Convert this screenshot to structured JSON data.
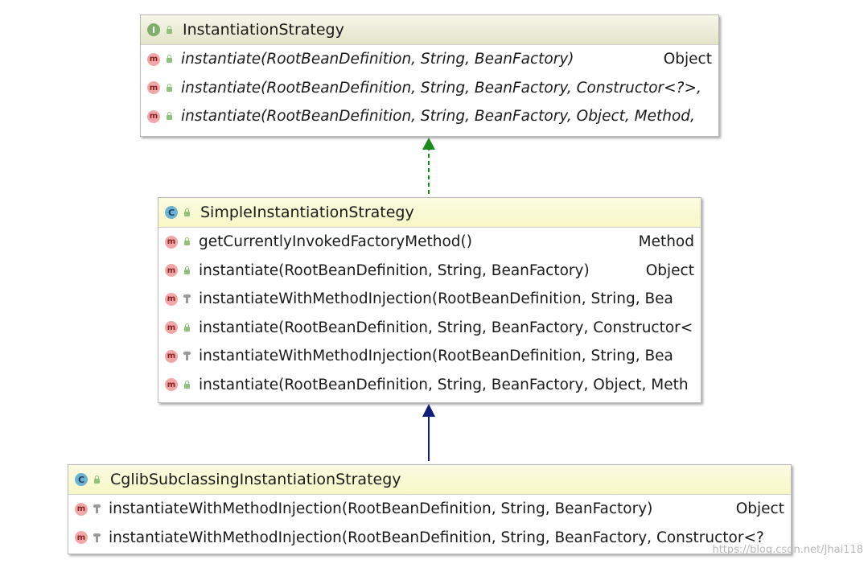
{
  "boxes": [
    {
      "kind": "interface",
      "icon_letter": "I",
      "title": "InstantiationStrategy",
      "methods": [
        {
          "visibility": "public",
          "sig": "instantiate(RootBeanDefinition, String, BeanFactory)",
          "ret": "Object"
        },
        {
          "visibility": "public",
          "sig": "instantiate(RootBeanDefinition, String, BeanFactory, Constructor<?>,",
          "ret": ""
        },
        {
          "visibility": "public",
          "sig": "instantiate(RootBeanDefinition, String, BeanFactory, Object, Method,",
          "ret": ""
        }
      ]
    },
    {
      "kind": "class",
      "icon_letter": "C",
      "title": "SimpleInstantiationStrategy",
      "methods": [
        {
          "visibility": "public",
          "static": true,
          "sig": "getCurrentlyInvokedFactoryMethod()",
          "ret": "Method"
        },
        {
          "visibility": "public",
          "sig": "instantiate(RootBeanDefinition, String, BeanFactory)",
          "ret": "Object"
        },
        {
          "visibility": "protected",
          "sig": "instantiateWithMethodInjection(RootBeanDefinition, String, Bea",
          "ret": ""
        },
        {
          "visibility": "public",
          "sig": "instantiate(RootBeanDefinition, String, BeanFactory, Constructor<",
          "ret": ""
        },
        {
          "visibility": "protected",
          "sig": "instantiateWithMethodInjection(RootBeanDefinition, String, Bea",
          "ret": ""
        },
        {
          "visibility": "public",
          "sig": "instantiate(RootBeanDefinition, String, BeanFactory, Object, Meth",
          "ret": ""
        }
      ]
    },
    {
      "kind": "class",
      "icon_letter": "C",
      "title": "CglibSubclassingInstantiationStrategy",
      "methods": [
        {
          "visibility": "protected",
          "sig": "instantiateWithMethodInjection(RootBeanDefinition, String, BeanFactory)",
          "ret": "Object"
        },
        {
          "visibility": "protected",
          "sig": "instantiateWithMethodInjection(RootBeanDefinition, String, BeanFactory, Constructor<?",
          "ret": ""
        }
      ]
    }
  ],
  "method_icon_letter": "m",
  "relations": [
    {
      "from": "SimpleInstantiationStrategy",
      "to": "InstantiationStrategy",
      "type": "implements",
      "style": "dashed",
      "color": "#1a8a1a"
    },
    {
      "from": "CglibSubclassingInstantiationStrategy",
      "to": "SimpleInstantiationStrategy",
      "type": "extends",
      "style": "solid",
      "color": "#10207a"
    }
  ],
  "watermark": "https://blog.csdn.net/Jhai118",
  "colors": {
    "interface_header": "#e4e3c9",
    "class_header": "#f7f7c6",
    "method_icon": "#f1a7a7"
  }
}
